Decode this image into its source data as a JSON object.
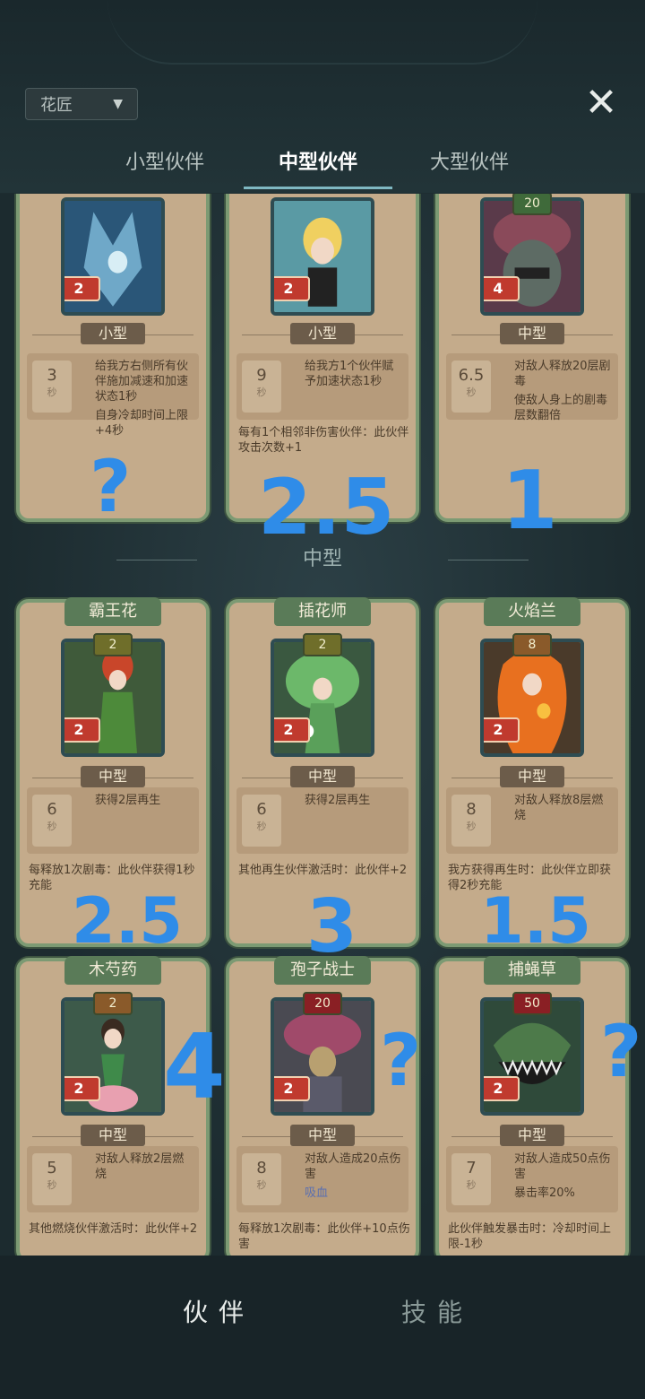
{
  "filter": {
    "label": "花匠"
  },
  "tabs": [
    "小型伙伴",
    "中型伙伴",
    "大型伙伴"
  ],
  "top_row": [
    {
      "size": "小型",
      "level": "2",
      "cd": "3",
      "cd_unit": "秒",
      "effect1": "给我方右侧所有伙伴施加减速和加速状态1秒",
      "effect2": "自身冷却时间上限+4秒",
      "note": ""
    },
    {
      "size": "小型",
      "level": "2",
      "cd": "9",
      "cd_unit": "秒",
      "effect1": "给我方1个伙伴赋予加速状态1秒",
      "effect2": "",
      "note": "每有1个相邻非伤害伙伴：此伙伴攻击次数+1"
    },
    {
      "size": "中型",
      "level": "4",
      "cost": "20",
      "cd": "6.5",
      "cd_unit": "秒",
      "effect1": "对敌人释放20层剧毒",
      "effect2": "使敌人身上的剧毒层数翻倍",
      "note": ""
    }
  ],
  "section_title": "中型",
  "cards": [
    {
      "name": "霸王花",
      "cost": "2",
      "level": "2",
      "size": "中型",
      "cd": "6",
      "cd_unit": "秒",
      "effect1": "获得2层再生",
      "effect2": "",
      "note": "每释放1次剧毒：此伙伴获得1秒充能"
    },
    {
      "name": "插花师",
      "cost": "2",
      "level": "2",
      "size": "中型",
      "cd": "6",
      "cd_unit": "秒",
      "effect1": "获得2层再生",
      "effect2": "",
      "note": "其他再生伙伴激活时：此伙伴+2"
    },
    {
      "name": "火焰兰",
      "cost": "8",
      "level": "2",
      "size": "中型",
      "cd": "8",
      "cd_unit": "秒",
      "effect1": "对敌人释放8层燃烧",
      "effect2": "",
      "note": "我方获得再生时：此伙伴立即获得2秒充能"
    },
    {
      "name": "木芍药",
      "cost": "2",
      "level": "2",
      "size": "中型",
      "cd": "5",
      "cd_unit": "秒",
      "effect1": "对敌人释放2层燃烧",
      "effect2": "",
      "note": "其他燃烧伙伴激活时：此伙伴+2"
    },
    {
      "name": "孢子战士",
      "cost": "20",
      "level": "2",
      "size": "中型",
      "cd": "8",
      "cd_unit": "秒",
      "effect1": "对敌人造成20点伤害",
      "effect2": "吸血",
      "note": "每释放1次剧毒：此伙伴+10点伤害"
    },
    {
      "name": "捕蝇草",
      "cost": "50",
      "level": "2",
      "size": "中型",
      "cd": "7",
      "cd_unit": "秒",
      "effect1": "对敌人造成50点伤害",
      "effect2": "暴击率20%",
      "note": "此伙伴触发暴击时：冷却时间上限-1秒"
    }
  ],
  "annotations": [
    "?",
    "2.5",
    "1",
    "2.5",
    "3",
    "1.5",
    "4",
    "?",
    "?"
  ],
  "bottom_tabs": [
    "伙伴",
    "技能"
  ],
  "colors": {
    "card_bg": "#c4ab8b",
    "card_border": "#7c9a73",
    "bg": "#1e2d31",
    "annotation": "#2f8ce8"
  }
}
